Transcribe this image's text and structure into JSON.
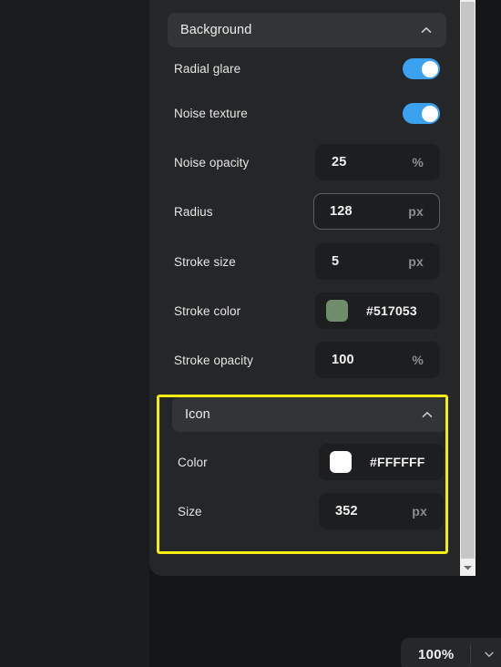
{
  "app": {
    "theme_background": "#141618",
    "canvas_background": "#1a1c1e",
    "panel_background": "#242628",
    "field_background": "#1c1e20",
    "accent_toggle": "#3ba2ef",
    "highlight_color": "#f5ec13"
  },
  "panel": {
    "sections": [
      {
        "id": "background",
        "title": "Background",
        "collapse_icon": "chevron-up-icon",
        "expanded": true,
        "highlighted": false,
        "rows": [
          {
            "label": "Radial glare",
            "control": "toggle",
            "value": "on"
          },
          {
            "label": "Noise texture",
            "control": "toggle",
            "value": "on"
          },
          {
            "label": "Noise opacity",
            "control": "number",
            "value": "25",
            "unit": "%",
            "focused": false
          },
          {
            "label": "Radius",
            "control": "number",
            "value": "128",
            "unit": "px",
            "focused": true
          },
          {
            "label": "Stroke size",
            "control": "number",
            "value": "5",
            "unit": "px",
            "focused": false
          },
          {
            "label": "Stroke color",
            "control": "color",
            "value": "#517053",
            "swatch": "#6f8c6b",
            "focused": false
          },
          {
            "label": "Stroke opacity",
            "control": "number",
            "value": "100",
            "unit": "%",
            "focused": false
          }
        ]
      },
      {
        "id": "icon",
        "title": "Icon",
        "collapse_icon": "chevron-up-icon",
        "expanded": true,
        "highlighted": true,
        "rows": [
          {
            "label": "Color",
            "control": "color",
            "value": "#FFFFFF",
            "swatch": "#ffffff",
            "focused": false
          },
          {
            "label": "Size",
            "control": "number",
            "value": "352",
            "unit": "px",
            "focused": false
          }
        ]
      }
    ]
  },
  "scrollbar": {
    "orientation": "vertical",
    "down_button_icon": "scroll-down-arrow-icon"
  },
  "zoom_control": {
    "value": "100%",
    "dropdown_icon": "chevron-down-icon"
  }
}
